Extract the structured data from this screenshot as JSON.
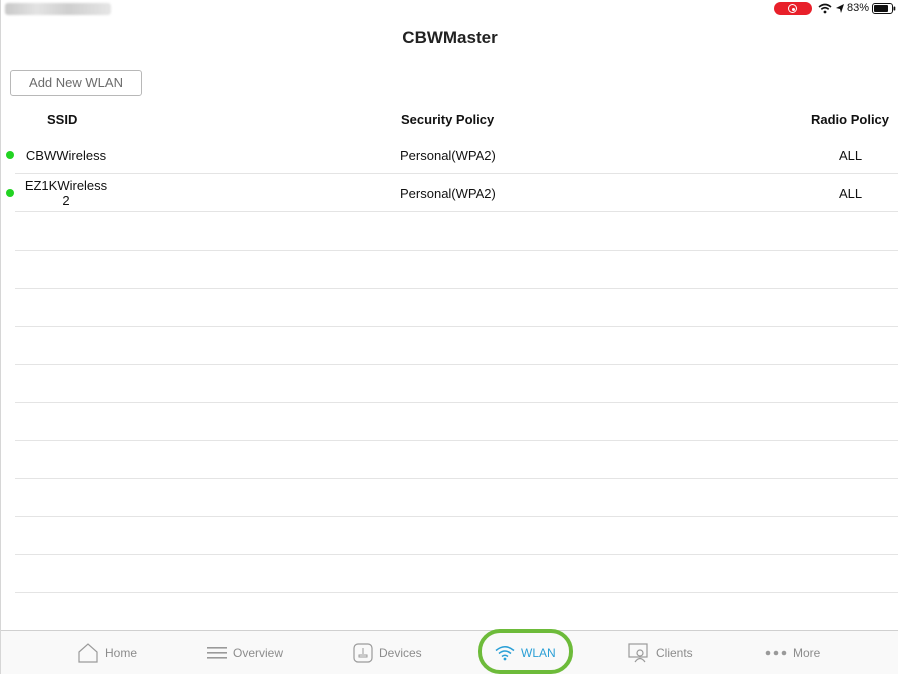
{
  "status_bar": {
    "battery_percent": "83%",
    "recording": true
  },
  "header": {
    "title": "CBWMaster"
  },
  "toolbar": {
    "add_button_label": "Add New WLAN"
  },
  "table": {
    "columns": {
      "ssid": "SSID",
      "security_policy": "Security Policy",
      "radio_policy": "Radio Policy"
    },
    "rows": [
      {
        "ssid": "CBWWireless",
        "security_policy": "Personal(WPA2)",
        "radio_policy": "ALL",
        "status": "active"
      },
      {
        "ssid": "EZ1KWireless 2",
        "security_policy": "Personal(WPA2)",
        "radio_policy": "ALL",
        "status": "active"
      }
    ]
  },
  "tab_bar": {
    "active": "wlan",
    "tabs": {
      "home": "Home",
      "overview": "Overview",
      "devices": "Devices",
      "wlan": "WLAN",
      "clients": "Clients",
      "more": "More"
    }
  },
  "colors": {
    "active_tab": "#2a9fd6",
    "status_active": "#22d322",
    "highlight": "#6dbb3a",
    "record": "#e8202a"
  }
}
